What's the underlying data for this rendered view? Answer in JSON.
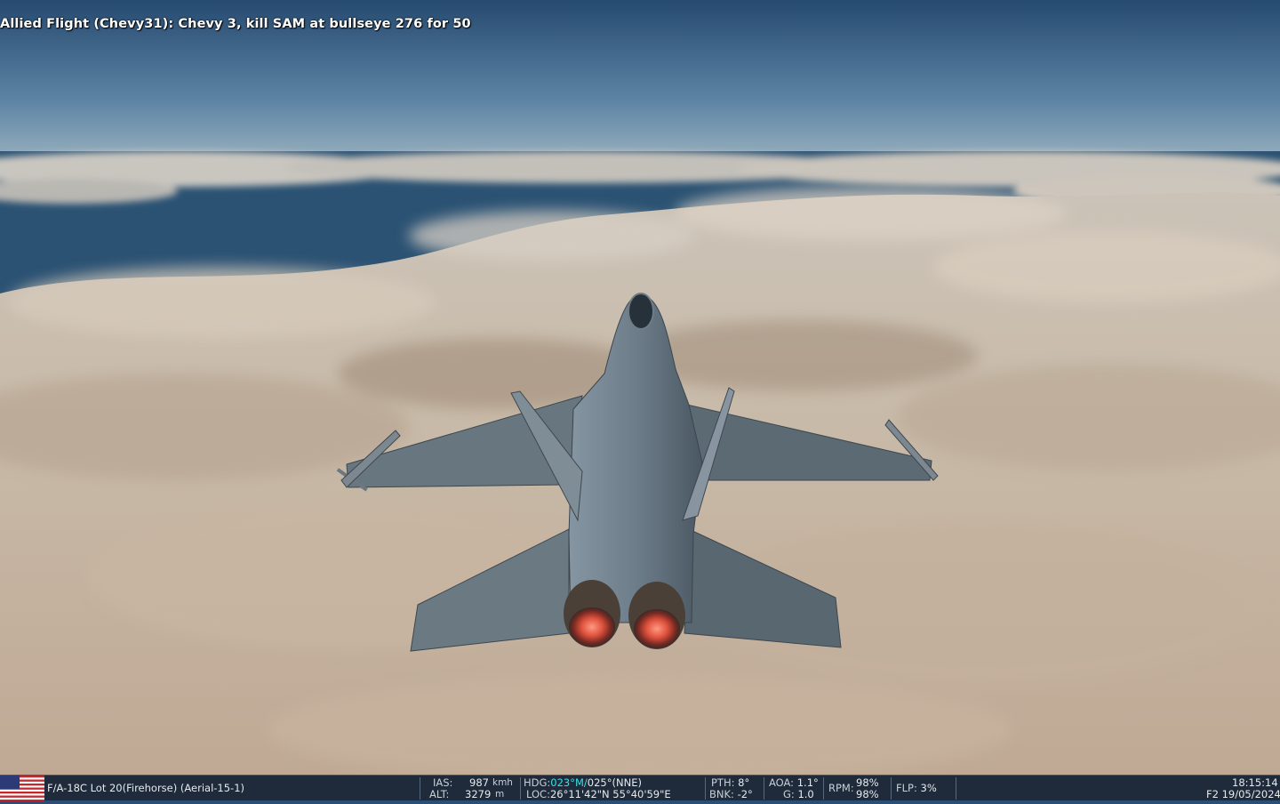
{
  "radio_message": "Allied Flight (Chevy31): Chevy 3, kill SAM at bullseye 276 for 50",
  "status_bar": {
    "flag_icon": "us-flag-icon",
    "aircraft": "F/A-18C Lot 20(Firehorse) (Aerial-15-1)",
    "ias": {
      "label": "IAS:",
      "value": "987",
      "unit": "kmh"
    },
    "alt": {
      "label": "ALT:",
      "value": "3279",
      "unit": "m"
    },
    "hdg": {
      "label": "HDG:",
      "magnetic": "023°M/",
      "true": "025°(NNE)"
    },
    "loc": {
      "label": "LOC:",
      "value": "26°11'42\"N 55°40'59\"E"
    },
    "pth": {
      "label": "PTH:",
      "value": "8°"
    },
    "bnk": {
      "label": "BNK:",
      "value": "-2°"
    },
    "aoa": {
      "label": "AOA:",
      "value": "1.1°"
    },
    "g": {
      "label": "G:",
      "value": "1.0"
    },
    "rpm": {
      "label": "RPM:",
      "value_1": "98%",
      "value_2": "98%"
    },
    "flp": {
      "label": "FLP:",
      "value": "3%"
    },
    "time": "18:15:14",
    "view": "F2",
    "date": "19/05/2024"
  },
  "colors": {
    "sky_top": "#2a4e74",
    "sky_horizon": "#9fb6c2",
    "sea": "#284f6c",
    "cloud": "#cdbfae",
    "aircraft": "#5b6a76",
    "afterburner": "#e0533e",
    "hud_cyan": "#31e3e6",
    "status_bg": "#1f2b3a"
  }
}
